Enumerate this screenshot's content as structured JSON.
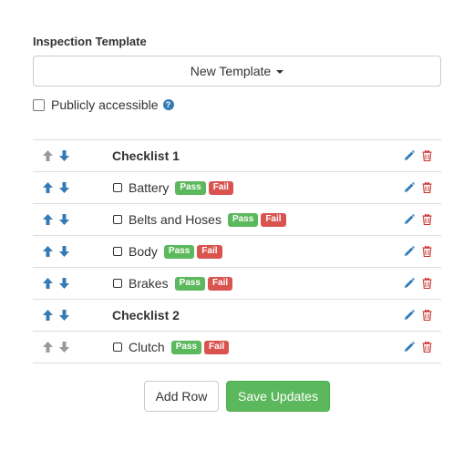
{
  "section_label": "Inspection Template",
  "template_dropdown": {
    "label": "New Template"
  },
  "public_access": {
    "label": "Publicly accessible",
    "checked": false,
    "help_icon": "question-circle-icon"
  },
  "rows": [
    {
      "type": "checklist",
      "label": "Checklist 1",
      "up_enabled": false,
      "down_enabled": true
    },
    {
      "type": "item",
      "label": "Battery",
      "pass": "Pass",
      "fail": "Fail",
      "up_enabled": true,
      "down_enabled": true
    },
    {
      "type": "item",
      "label": "Belts and Hoses",
      "pass": "Pass",
      "fail": "Fail",
      "up_enabled": true,
      "down_enabled": true
    },
    {
      "type": "item",
      "label": "Body",
      "pass": "Pass",
      "fail": "Fail",
      "up_enabled": true,
      "down_enabled": true
    },
    {
      "type": "item",
      "label": "Brakes",
      "pass": "Pass",
      "fail": "Fail",
      "up_enabled": true,
      "down_enabled": true
    },
    {
      "type": "checklist",
      "label": "Checklist 2",
      "up_enabled": true,
      "down_enabled": true
    },
    {
      "type": "item",
      "label": "Clutch",
      "pass": "Pass",
      "fail": "Fail",
      "up_enabled": false,
      "down_enabled": false
    }
  ],
  "buttons": {
    "add_row": "Add Row",
    "save_updates": "Save Updates"
  },
  "colors": {
    "arrow_active": "#337ab7",
    "arrow_disabled": "#999999",
    "edit_icon": "#337ab7",
    "delete_icon": "#c9302c",
    "pass_badge": "#5cb85c",
    "fail_badge": "#d9534f",
    "save_button": "#5cb85c"
  }
}
